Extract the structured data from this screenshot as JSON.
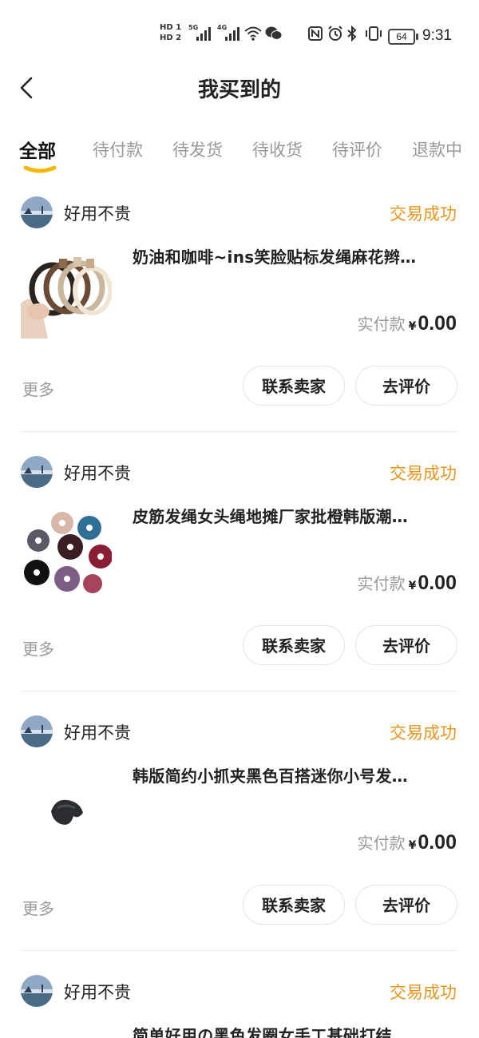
{
  "status_bar": {
    "hd1": "HD 1",
    "hd2": "HD 2",
    "sig1_label": "5G",
    "sig2_label": "4G",
    "battery": "64",
    "time": "9:31"
  },
  "header": {
    "title": "我买到的"
  },
  "tabs": [
    {
      "label": "全部"
    },
    {
      "label": "待付款"
    },
    {
      "label": "待发货"
    },
    {
      "label": "待收货"
    },
    {
      "label": "待评价"
    },
    {
      "label": "退款中"
    }
  ],
  "accent_color": "#f5b800",
  "status_color": "#e8961e",
  "orders": [
    {
      "shop_name": "好用不贵",
      "status": "交易成功",
      "title": "奶油和咖啡~ins笑脸贴标发绳麻花辫…",
      "pay_label": "实付款",
      "currency": "¥",
      "amount": "0.00",
      "more": "更多",
      "btn_contact": "联系卖家",
      "btn_review": "去评价"
    },
    {
      "shop_name": "好用不贵",
      "status": "交易成功",
      "title": "皮筋发绳女头绳地摊厂家批橙韩版潮…",
      "pay_label": "实付款",
      "currency": "¥",
      "amount": "0.00",
      "more": "更多",
      "btn_contact": "联系卖家",
      "btn_review": "去评价"
    },
    {
      "shop_name": "好用不贵",
      "status": "交易成功",
      "title": "韩版简约小抓夹黑色百搭迷你小号发…",
      "pay_label": "实付款",
      "currency": "¥",
      "amount": "0.00",
      "more": "更多",
      "btn_contact": "联系卖家",
      "btn_review": "去评价"
    },
    {
      "shop_name": "好用不贵",
      "status": "交易成功",
      "title": "简单好用の黑色发圈女手工基础打结…"
    }
  ]
}
